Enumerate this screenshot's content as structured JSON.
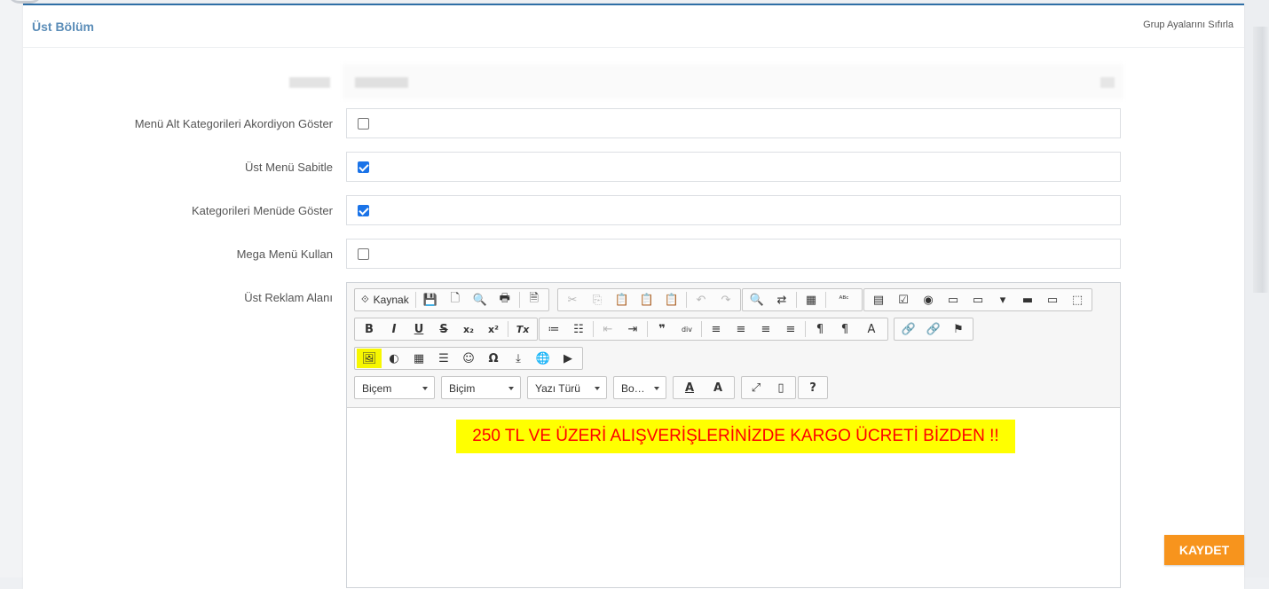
{
  "panel": {
    "title": "Üst Bölüm",
    "reset_link": "Grup Ayalarını Sıfırla"
  },
  "form": {
    "rows": [
      {
        "label": "Menü Alt Kategorileri Akordiyon Göster",
        "checked": false
      },
      {
        "label": "Üst Menü Sabitle",
        "checked": true
      },
      {
        "label": "Kategorileri Menüde Göster",
        "checked": true
      },
      {
        "label": "Mega Menü Kullan",
        "checked": false
      }
    ],
    "editor_label": "Üst Reklam Alanı"
  },
  "editor": {
    "source_label": "Kaynak",
    "selects": {
      "style": "Biçem",
      "format": "Biçim",
      "font": "Yazı Türü",
      "size": "Bo…"
    },
    "content_text": "250 TL VE ÜZERİ ALIŞVERİŞLERİNİZDE KARGO ÜCRETİ BİZDEN !!",
    "content_bg": "#ffff00",
    "content_color": "#ff0000"
  },
  "icons": {
    "save": "💾",
    "new_page": "🗋",
    "preview": "🔍",
    "print": "🖶",
    "templates": "🗎",
    "cut": "✂",
    "copy": "⎘",
    "paste": "📋",
    "paste_text": "📋",
    "paste_word": "📋",
    "undo": "↶",
    "redo": "↷",
    "find": "🔍",
    "replace": "⇄",
    "select_all": "▦",
    "spellcheck": "ᴬᴮᶜ",
    "form": "▤",
    "checkbox": "☑",
    "radio": "◉",
    "textfield": "▭",
    "textarea": "▭",
    "select": "▾",
    "button": "▬",
    "imagebutton": "▭",
    "hiddenfield": "⬚",
    "bold": "B",
    "italic": "I",
    "underline": "U",
    "strike": "S",
    "subscript": "x₂",
    "superscript": "x²",
    "remove_format": "Tx",
    "numbered_list": "≔",
    "bulleted_list": "☷",
    "outdent": "⇤",
    "indent": "⇥",
    "blockquote": "❞",
    "div": "div",
    "align_left": "≡",
    "align_center": "≡",
    "align_right": "≡",
    "justify": "≡",
    "ltr": "¶",
    "rtl": "¶",
    "language": "A",
    "link": "🔗",
    "unlink": "🔗",
    "anchor": "⚑",
    "image": "🖼",
    "flash": "◐",
    "table": "▦",
    "hr": "☰",
    "smiley": "☺",
    "special_char": "Ω",
    "page_break": "⤓",
    "iframe": "🌐",
    "youtube": "▶",
    "text_color": "A",
    "bg_color": "A",
    "maximize": "⤢",
    "show_blocks": "▯",
    "about": "?"
  },
  "save_button": "KAYDET",
  "colors": {
    "header_accent": "#2f6fa6",
    "title": "#5b8db8",
    "save_bg": "#f7941d",
    "checkbox_on": "#1a73e8"
  }
}
